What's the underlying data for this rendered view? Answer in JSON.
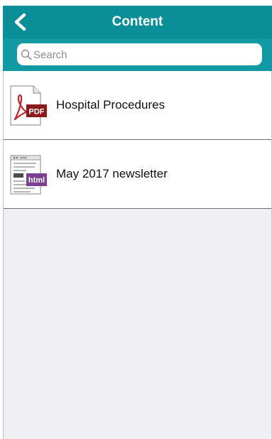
{
  "header": {
    "title": "Content",
    "back_icon": "chevron-left-icon"
  },
  "search": {
    "placeholder": "Search",
    "value": "",
    "icon": "search-icon"
  },
  "items": [
    {
      "label": "Hospital Procedures",
      "icon": "pdf-file-icon",
      "badge": "PDF"
    },
    {
      "label": "May 2017 newsletter",
      "icon": "html-file-icon",
      "badge": "html"
    }
  ],
  "colors": {
    "header_bg": "#0a8e98",
    "search_bar_bg": "#119aa4",
    "empty_bg": "#efeff4",
    "pdf_badge": "#8b1a1a",
    "html_badge": "#7b3f8f"
  }
}
